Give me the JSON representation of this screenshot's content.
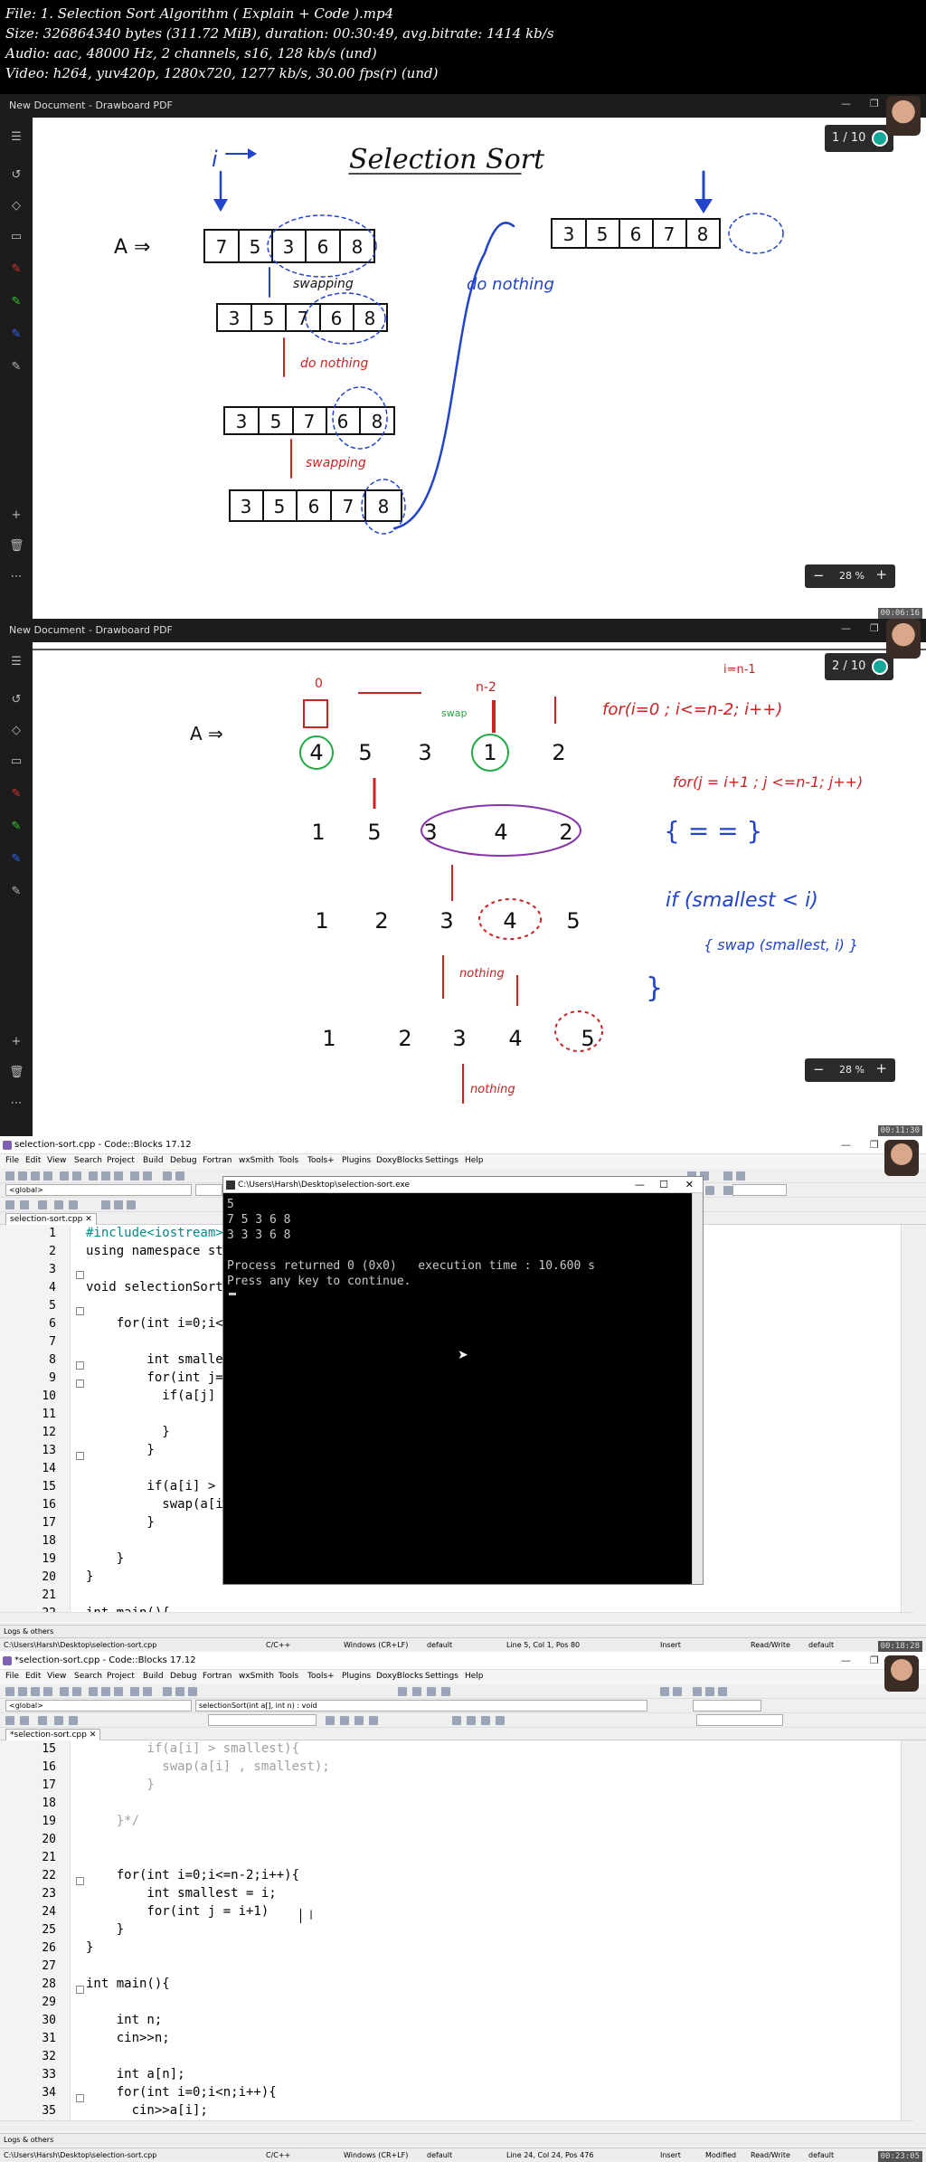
{
  "header": {
    "file": "File: 1. Selection Sort Algorithm ( Explain + Code ).mp4",
    "size": "Size: 326864340 bytes (311.72 MiB), duration: 00:30:49, avg.bitrate: 1414 kb/s",
    "audio": "Audio: aac, 48000 Hz, 2 channels, s16, 128 kb/s (und)",
    "video": "Video: h264, yuv420p, 1280x720, 1277 kb/s, 30.00 fps(r) (und)"
  },
  "frames": [
    {
      "window_title": "New Document - Drawboard PDF",
      "page": "1 / 10",
      "zoom": "28 %",
      "timestamp": "00:06:16",
      "ink": {
        "title": "Selection Sort",
        "pointer": "i",
        "array_label": "A ⇒",
        "arrays": [
          [
            "7",
            "5",
            "3",
            "6",
            "8"
          ],
          [
            "3",
            "5",
            "7",
            "6",
            "8"
          ],
          [
            "3",
            "5",
            "7",
            "6",
            "8"
          ],
          [
            "3",
            "5",
            "6",
            "7",
            "8"
          ],
          [
            "3",
            "5",
            "6",
            "7",
            "8"
          ]
        ],
        "steps": [
          "swapping",
          "do nothing",
          "swapping",
          "do nothing"
        ]
      }
    },
    {
      "window_title": "New Document - Drawboard PDF",
      "page": "2 / 10",
      "zoom": "28 %",
      "timestamp": "00:11:30",
      "ink": {
        "array_label": "A ⇒",
        "rows": [
          [
            "4",
            "5",
            "3",
            "1",
            "2"
          ],
          [
            "1",
            "5",
            "3",
            "4",
            "2"
          ],
          [
            "1",
            "2",
            "3",
            "4",
            "5"
          ],
          [
            "1",
            "2",
            "3",
            "4",
            "5"
          ]
        ],
        "marks": [
          "0",
          "n-2",
          "swap",
          "i=n-1",
          "nothing",
          "nothing"
        ],
        "outer_loop": "for(i=0 ; i<=n-2; i++)",
        "inner_loop": "for(j = i+1 ; j <=n-1; j++)",
        "condition": "if (smallest < i)",
        "swap": "{ swap (smallest, i) }"
      }
    },
    {
      "window_title": "selection-sort.cpp - Code::Blocks 17.12",
      "menu": [
        "File",
        "Edit",
        "View",
        "Search",
        "Project",
        "Build",
        "Debug",
        "Fortran",
        "wxSmith",
        "Tools",
        "Tools+",
        "Plugins",
        "DoxyBlocks",
        "Settings",
        "Help"
      ],
      "scope": "<global>",
      "tab": "selection-sort.cpp",
      "timestamp": "00:18:28",
      "lines": [
        {
          "n": "1",
          "code": "#include<iostream>"
        },
        {
          "n": "2",
          "code": "using namespace std;"
        },
        {
          "n": "3",
          "code": ""
        },
        {
          "n": "4",
          "code": "void selectionSort(int a[], int n){"
        },
        {
          "n": "5",
          "code": ""
        },
        {
          "n": "6",
          "code": "    for(int i=0;i<=n-2;i++){"
        },
        {
          "n": "7",
          "code": ""
        },
        {
          "n": "8",
          "code": "        int smallest = i;"
        },
        {
          "n": "9",
          "code": "        for(int j=i+1;j<=n-1;j++){"
        },
        {
          "n": "10",
          "code": "          if(a[j] < a[smallest])"
        },
        {
          "n": "11",
          "code": ""
        },
        {
          "n": "12",
          "code": "          }"
        },
        {
          "n": "13",
          "code": "        }"
        },
        {
          "n": "14",
          "code": ""
        },
        {
          "n": "15",
          "code": "        if(a[i] > smallest){"
        },
        {
          "n": "16",
          "code": "          swap(a[i] , smallest);"
        },
        {
          "n": "17",
          "code": "        }"
        },
        {
          "n": "18",
          "code": ""
        },
        {
          "n": "19",
          "code": "    }"
        },
        {
          "n": "20",
          "code": "}"
        },
        {
          "n": "21",
          "code": ""
        },
        {
          "n": "22",
          "code": "int main(){"
        }
      ],
      "console": {
        "title": "C:\\Users\\Harsh\\Desktop\\selection-sort.exe",
        "output": "5\n7 5 3 6 8\n3 3 3 6 8\n\nProcess returned 0 (0x0)   execution time : 10.600 s\nPress any key to continue."
      },
      "logs": "Logs & others",
      "status": {
        "path": "C:\\Users\\Harsh\\Desktop\\selection-sort.cpp",
        "lang": "C/C++",
        "eol": "Windows (CR+LF)",
        "enc": "default",
        "pos": "Line 5, Col 1, Pos 80",
        "mode": "Insert",
        "rw": "Read/Write",
        "def": "default"
      }
    },
    {
      "window_title": "*selection-sort.cpp - Code::Blocks 17.12",
      "menu": [
        "File",
        "Edit",
        "View",
        "Search",
        "Project",
        "Build",
        "Debug",
        "Fortran",
        "wxSmith",
        "Tools",
        "Tools+",
        "Plugins",
        "DoxyBlocks",
        "Settings",
        "Help"
      ],
      "scope": "<global>",
      "function_select": "selectionSort(int a[], int n) : void",
      "tab": "*selection-sort.cpp",
      "timestamp": "00:23:05",
      "lines": [
        {
          "n": "15",
          "code": "        if(a[i] > smallest){"
        },
        {
          "n": "16",
          "code": "          swap(a[i] , smallest);"
        },
        {
          "n": "17",
          "code": "        }"
        },
        {
          "n": "18",
          "code": ""
        },
        {
          "n": "19",
          "code": "    }*/"
        },
        {
          "n": "20",
          "code": ""
        },
        {
          "n": "21",
          "code": ""
        },
        {
          "n": "22",
          "code": "    for(int i=0;i<=n-2;i++){"
        },
        {
          "n": "23",
          "code": "        int smallest = i;"
        },
        {
          "n": "24",
          "code": "        for(int j = i+1)"
        },
        {
          "n": "25",
          "code": "    }"
        },
        {
          "n": "26",
          "code": "}"
        },
        {
          "n": "27",
          "code": ""
        },
        {
          "n": "28",
          "code": "int main(){"
        },
        {
          "n": "29",
          "code": ""
        },
        {
          "n": "30",
          "code": "    int n;"
        },
        {
          "n": "31",
          "code": "    cin>>n;"
        },
        {
          "n": "32",
          "code": ""
        },
        {
          "n": "33",
          "code": "    int a[n];"
        },
        {
          "n": "34",
          "code": "    for(int i=0;i<n;i++){"
        },
        {
          "n": "35",
          "code": "      cin>>a[i];"
        }
      ],
      "logs": "Logs & others",
      "status": {
        "path": "C:\\Users\\Harsh\\Desktop\\selection-sort.cpp",
        "lang": "C/C++",
        "eol": "Windows (CR+LF)",
        "enc": "default",
        "pos": "Line 24, Col 24, Pos 476",
        "mode": "Insert",
        "modified": "Modified",
        "rw": "Read/Write",
        "def": "default"
      }
    }
  ]
}
